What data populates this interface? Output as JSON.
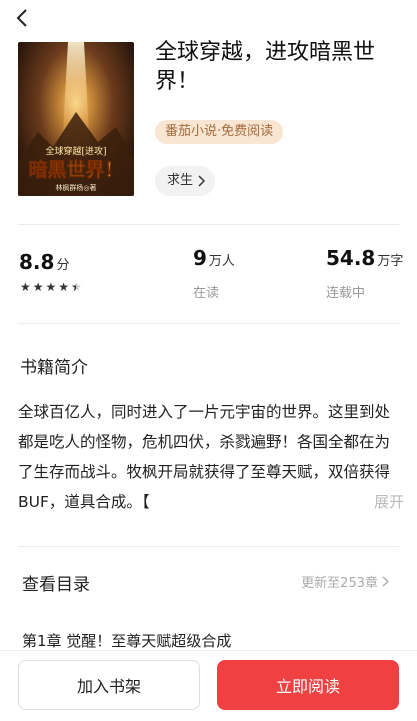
{
  "book": {
    "title": "全球穿越，进攻暗黑世界！",
    "tag": "番茄小说·免费阅读",
    "genre": "求生",
    "cover": {
      "top_text": "全球穿越[进攻]",
      "main_text": "暗黑世界！",
      "author_text": "林枫群杨◎著"
    }
  },
  "stats": {
    "score": {
      "value": "8.8",
      "unit": "分",
      "rating": 4.5,
      "max": 5
    },
    "readers": {
      "value": "9",
      "unit": "万人",
      "label": "在读"
    },
    "words": {
      "value": "54.8",
      "unit": "万字",
      "label": "连载中"
    }
  },
  "intro": {
    "heading": "书籍简介",
    "text": "全球百亿人，同时进入了一片元宇宙的世界。这里到处都是吃人的怪物，危机四伏，杀戮遍野！各国全都在为了生存而战斗。牧枫开局就获得了至尊天赋，双倍获得BUF，道具合成。【",
    "expand": "展开"
  },
  "catalog": {
    "label": "查看目录",
    "update": "更新至253章",
    "first_chapter": "第1章 觉醒！至尊天赋超级合成"
  },
  "actions": {
    "add_shelf": "加入书架",
    "read_now": "立即阅读"
  },
  "colors": {
    "accent_red": "#f04142",
    "tag_bg": "#f8e5d2",
    "tag_text": "#a66b3c"
  }
}
